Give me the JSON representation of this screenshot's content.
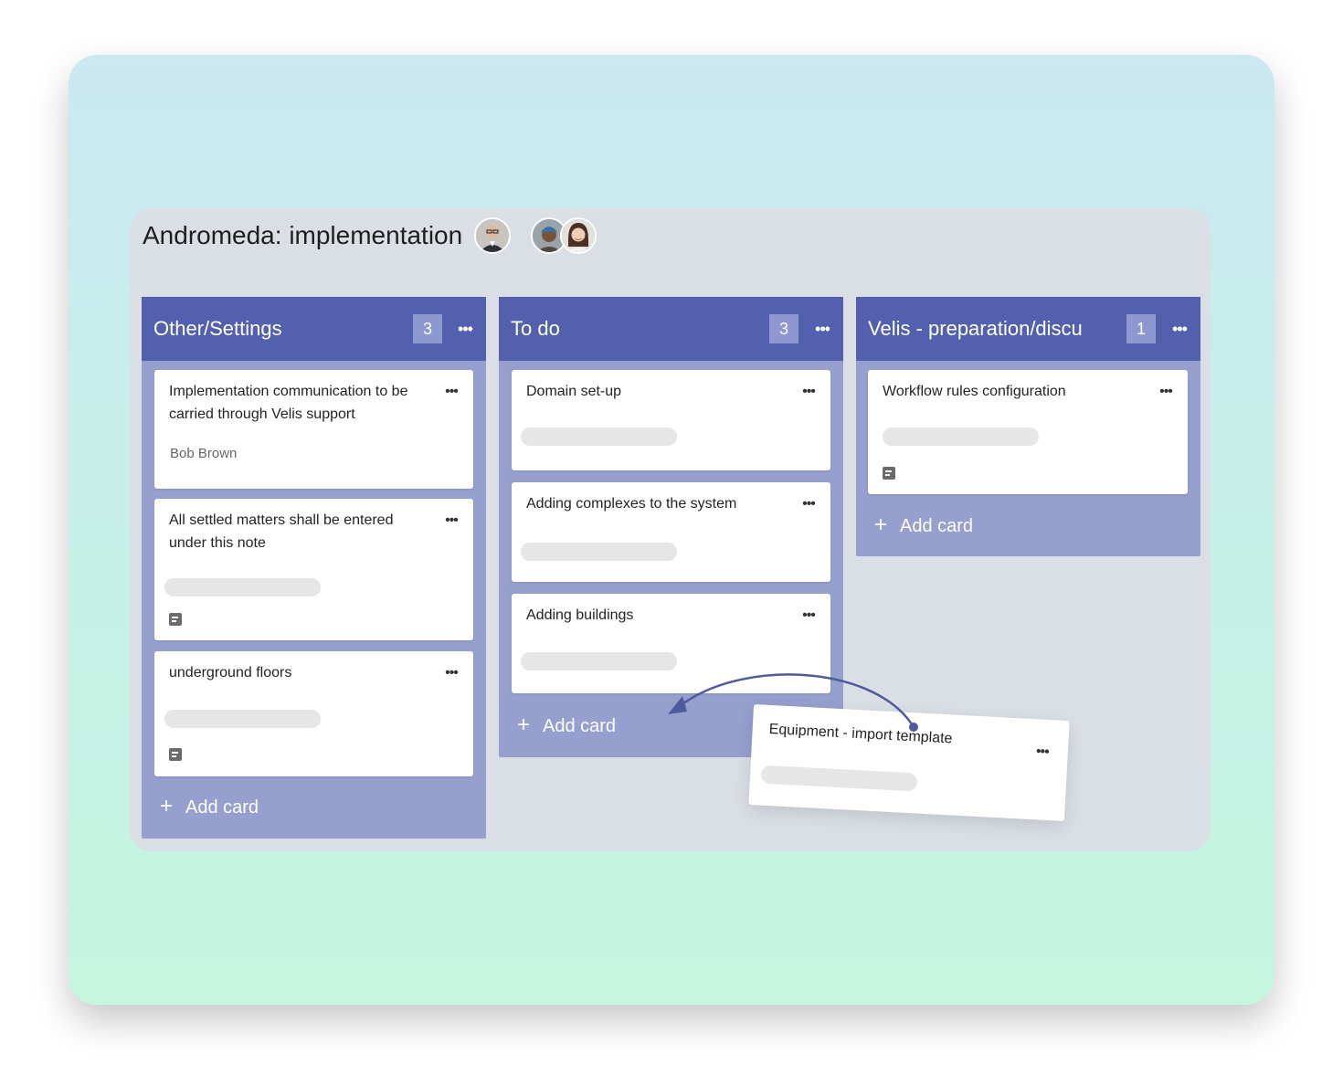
{
  "board": {
    "title": "Andromeda: implementation"
  },
  "avatars": [
    {
      "name": "avatar-man-glasses-icon"
    },
    {
      "name": "avatar-man-beanie-icon"
    },
    {
      "name": "avatar-woman-icon"
    }
  ],
  "columns": [
    {
      "title": "Other/Settings",
      "count": "3",
      "menu": "•••",
      "add_label": "Add card",
      "cards": [
        {
          "title": "Implementation communication to be carried through Velis support",
          "author": "Bob Brown",
          "menu": "•••"
        },
        {
          "title": "All settled matters shall be entered under this note",
          "menu": "•••"
        },
        {
          "title": "underground floors",
          "menu": "•••"
        }
      ]
    },
    {
      "title": "To do",
      "count": "3",
      "menu": "•••",
      "add_label": "Add card",
      "cards": [
        {
          "title": "Domain set-up",
          "menu": "•••"
        },
        {
          "title": "Adding complexes to the system",
          "menu": "•••"
        },
        {
          "title": "Adding buildings",
          "menu": "•••"
        }
      ]
    },
    {
      "title": "Velis - preparation/discu",
      "count": "1",
      "menu": "•••",
      "add_label": "Add card",
      "cards": [
        {
          "title": "Workflow rules configuration",
          "menu": "•••"
        }
      ]
    }
  ],
  "dragged_card": {
    "title": "Equipment - import template",
    "menu": "•••"
  },
  "colors": {
    "header": "#5360ad",
    "column": "#96a0cf",
    "board": "#d9dfe5",
    "arrow": "#4e5a9e"
  },
  "icons": {
    "add": "+",
    "note": "note-icon"
  }
}
